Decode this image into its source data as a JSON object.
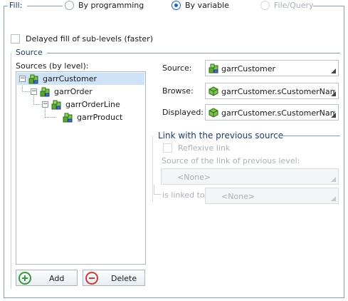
{
  "fill": {
    "legend": "Fill:",
    "options": [
      {
        "label": "By programming",
        "checked": false,
        "disabled": false
      },
      {
        "label": "By variable",
        "checked": true,
        "disabled": false
      },
      {
        "label": "File/Query",
        "checked": false,
        "disabled": true
      }
    ],
    "delayed_label": "Delayed fill of sub-levels (faster)",
    "delayed_checked": false
  },
  "source": {
    "legend": "Source",
    "tree_label": "Sources (by level):",
    "tree": [
      {
        "label": "garrCustomer",
        "level": 0,
        "selected": true,
        "icon": "variable-array-icon"
      },
      {
        "label": "garrOrder",
        "level": 1,
        "selected": false,
        "icon": "variable-array-icon"
      },
      {
        "label": "garrOrderLine",
        "level": 2,
        "selected": false,
        "icon": "variable-array-icon"
      },
      {
        "label": "garrProduct",
        "level": 3,
        "selected": false,
        "icon": "variable-array-icon"
      }
    ],
    "add_label": "Add",
    "delete_label": "Delete",
    "fields": {
      "source_label": "Source:",
      "source_value": "garrCustomer",
      "browse_label": "Browse:",
      "browse_value": "garrCustomer.sCustomerNam",
      "displayed_label": "Displayed:",
      "displayed_value": "garrCustomer.sCustomerNam"
    }
  },
  "link": {
    "legend": "Link with the previous source",
    "reflexive_label": "Reflexive link",
    "source_prev_label": "Source of the link of previous level:",
    "source_prev_value": "<None>",
    "is_linked_label": "is linked to",
    "is_linked_value": "<None>"
  },
  "colors": {
    "add_accent": "#3a9a3a",
    "delete_accent": "#d23a3a",
    "legend_text": "#1f3c62",
    "selection": "#cfe3f8"
  }
}
